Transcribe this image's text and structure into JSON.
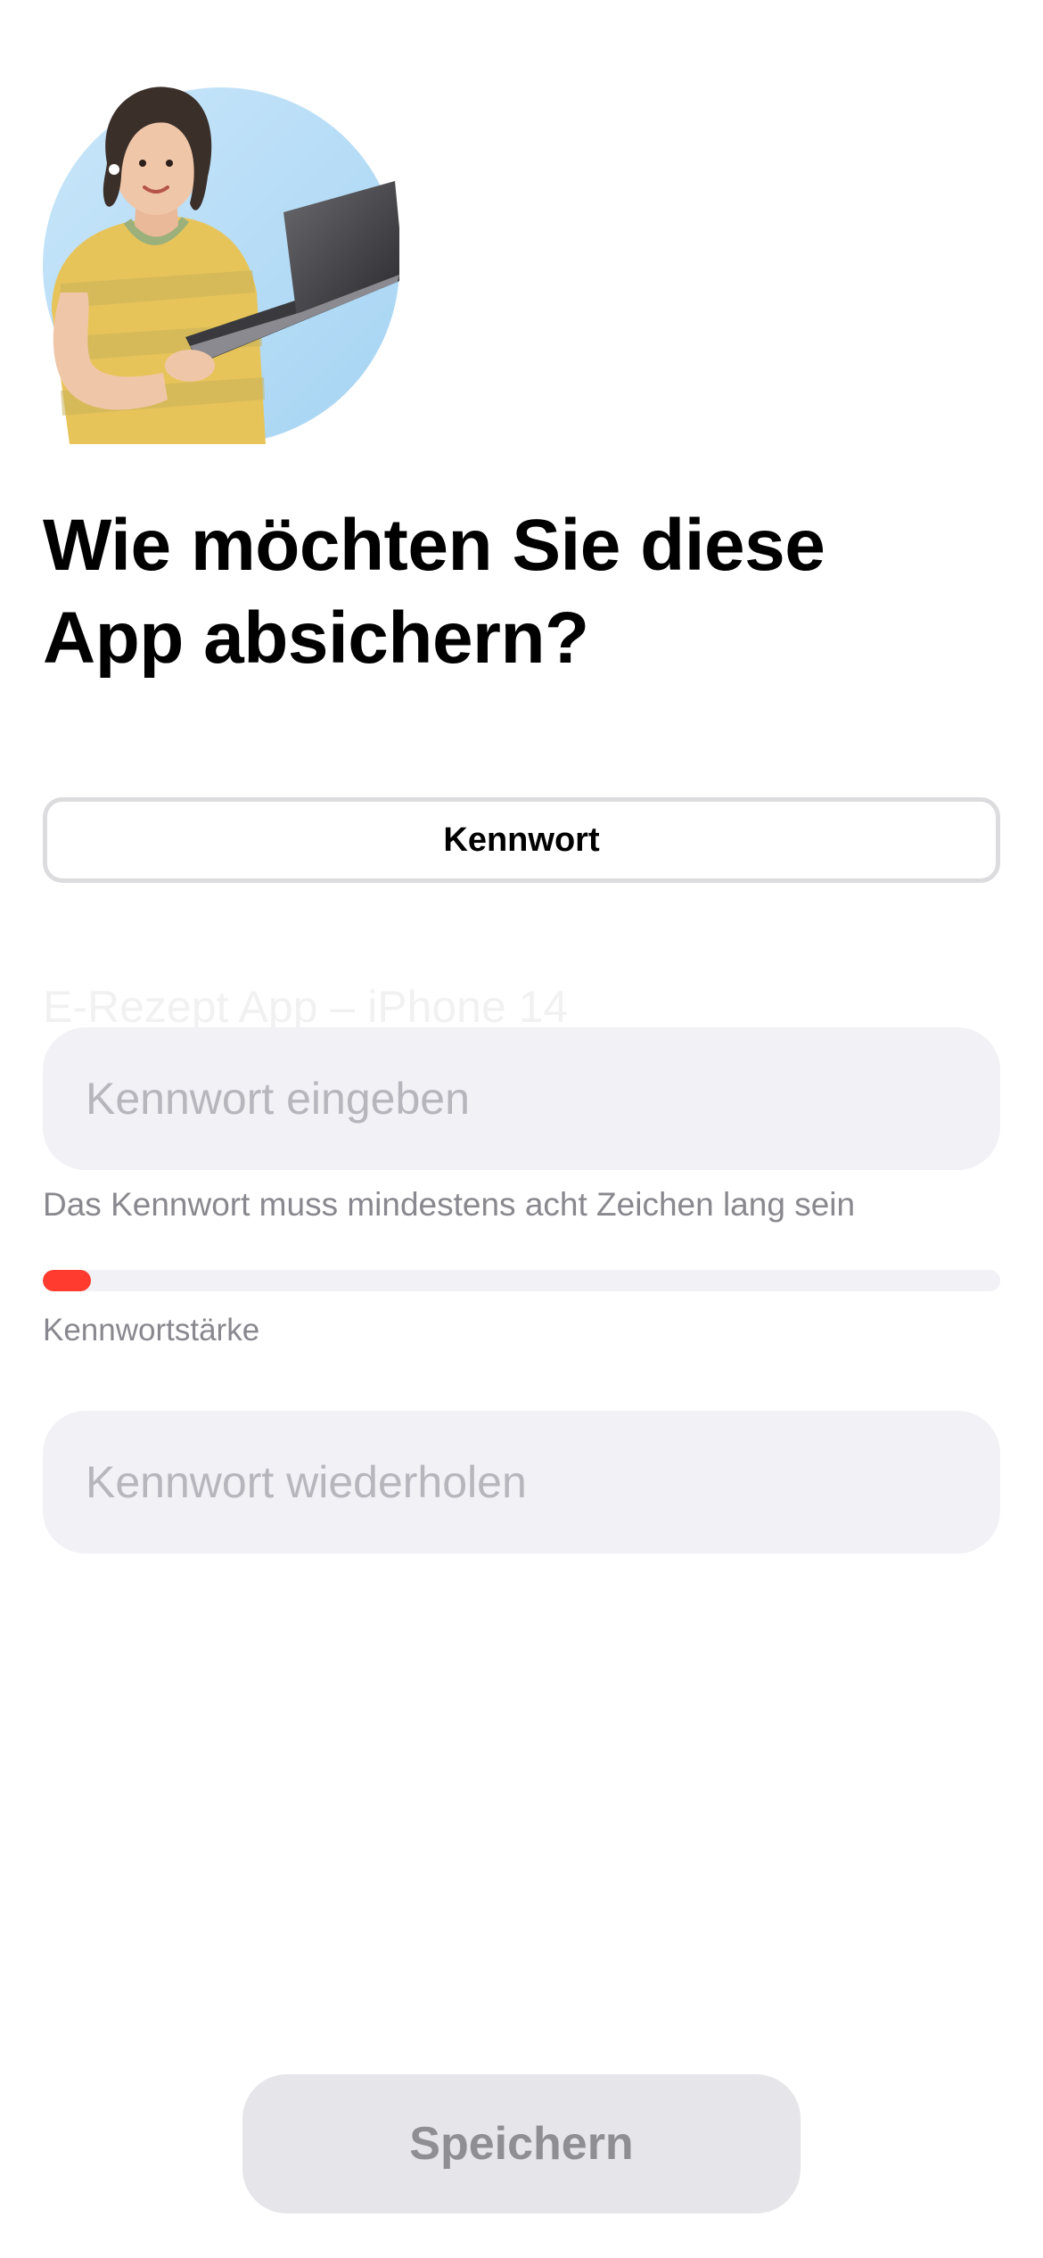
{
  "title": "Wie möchten Sie diese App absichern?",
  "method": {
    "label": "Kennwort"
  },
  "ghost_label": "E-Rezept App – iPhone 14",
  "password": {
    "placeholder": "Kennwort eingeben",
    "value": "",
    "hint": "Das Kennwort muss mindestens acht Zeichen lang sein"
  },
  "strength": {
    "label": "Kennwortstärke",
    "level_fraction": 0.05,
    "color": "#ff3b30"
  },
  "password_repeat": {
    "placeholder": "Kennwort wiederholen",
    "value": ""
  },
  "save": {
    "label": "Speichern",
    "enabled": false
  },
  "illustration": {
    "icon": "woman-with-laptop-illustration",
    "background_color": "#b3dcf6"
  }
}
